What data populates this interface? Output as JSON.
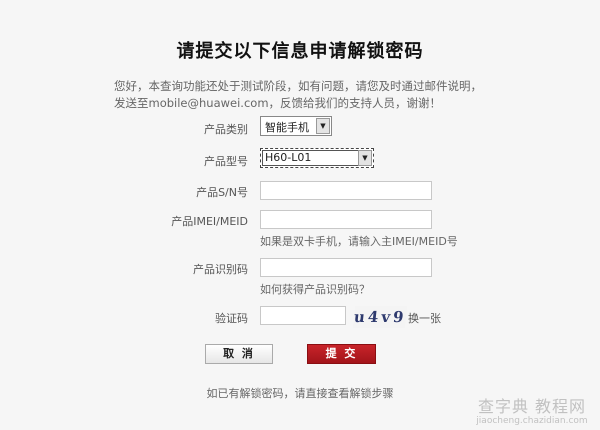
{
  "page": {
    "title": "请提交以下信息申请解锁密码",
    "intro": "您好，本查询功能还处于测试阶段，如有问题，请您及时通过邮件说明，发送至mobile@huawei.com，反馈给我们的支持人员，谢谢！"
  },
  "form": {
    "category": {
      "label": "产品类别",
      "value": "智能手机"
    },
    "model": {
      "label": "产品型号",
      "value": "H60-L01"
    },
    "sn": {
      "label": "产品S/N号",
      "value": ""
    },
    "imei": {
      "label": "产品IMEI/MEID",
      "value": "",
      "hint": "如果是双卡手机，请输入主IMEI/MEID号"
    },
    "product_id": {
      "label": "产品识别码",
      "value": "",
      "hint": "如何获得产品识别码？"
    },
    "captcha": {
      "label": "验证码",
      "value": "",
      "image_text": "u4v9",
      "refresh_label": "换一张"
    }
  },
  "buttons": {
    "cancel": "取 消",
    "submit": "提 交"
  },
  "footer": {
    "link": "如已有解锁密码，请直接查看解锁步骤"
  },
  "watermark": {
    "main": "查字典 教程网",
    "sub": "jiaocheng.chazidian.com"
  },
  "colors": {
    "background": "#f6f6f6",
    "submit_button": "#b51b20"
  }
}
